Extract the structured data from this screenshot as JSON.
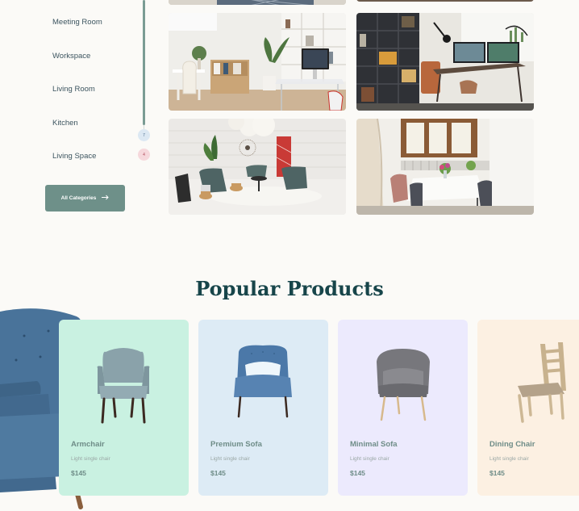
{
  "categories": [
    {
      "label": "Meeting Room"
    },
    {
      "label": "Workspace"
    },
    {
      "label": "Living Room"
    },
    {
      "label": "Kitchen",
      "badge": "7"
    },
    {
      "label": "Living Space",
      "badge": "4"
    }
  ],
  "all_categories_button": {
    "label": "All Categories",
    "icon": "arrow-right-icon"
  },
  "section": {
    "title": "Popular Products"
  },
  "products": [
    {
      "name": "Armchair",
      "desc": "Light single chair",
      "price": "$145",
      "bg": "#c9f1e1"
    },
    {
      "name": "Premium Sofa",
      "desc": "Light single chair",
      "price": "$145",
      "bg": "#ddebf5"
    },
    {
      "name": "Minimal Sofa",
      "desc": "Light single chair",
      "price": "$145",
      "bg": "#eceafd"
    },
    {
      "name": "Dining Chair",
      "desc": "Light single chair",
      "price": "$145",
      "bg": "#fcf0e2"
    }
  ]
}
